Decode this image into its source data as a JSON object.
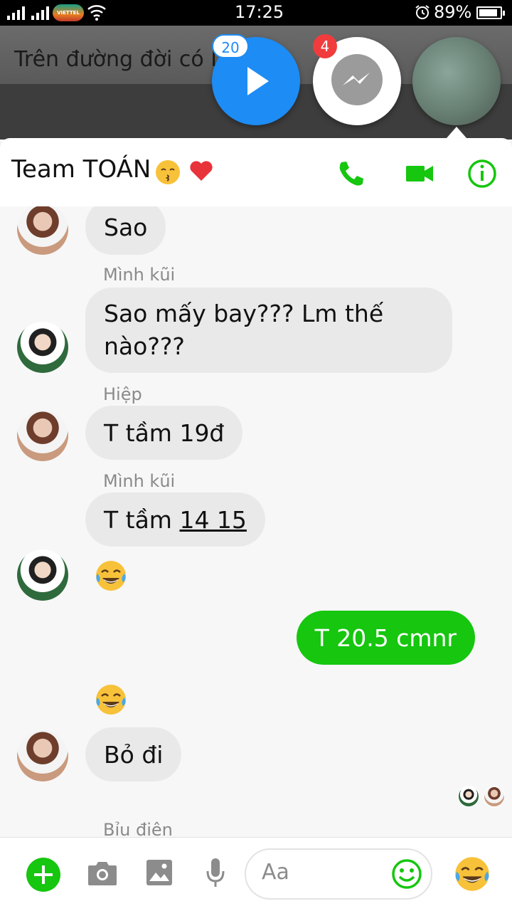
{
  "status_bar": {
    "time": "17:25",
    "battery": "89%",
    "battery_level": 0.89
  },
  "background_post": {
    "text": "Trên đường đời có Da    ên"
  },
  "chat_heads": {
    "play_badge": "20",
    "messenger_badge": "4"
  },
  "header": {
    "title": "Team TOÁN",
    "icons": [
      "kissing-emoji",
      "red-heart-emoji",
      "phone-icon",
      "video-icon",
      "info-icon"
    ],
    "accent_color": "#16c60f"
  },
  "messages": [
    {
      "sender": "",
      "text": "Sao",
      "mine": false
    },
    {
      "sender": "Mình kũi",
      "text": "Sao mấy bay??? Lm thế nào???",
      "mine": false
    },
    {
      "sender": "Hiệp",
      "text": "T tầm 19đ",
      "mine": false
    },
    {
      "sender": "Mình kũi",
      "text_prefix": "T tầm ",
      "text_underlined": "14 15",
      "mine": false
    },
    {
      "sender": "",
      "emoji": "face-with-tears-of-joy",
      "mine": false
    },
    {
      "sender": "",
      "text": "T 20.5 cmnr",
      "mine": true
    },
    {
      "sender": "",
      "emoji": "face-with-tears-of-joy",
      "mine": true
    },
    {
      "sender": "",
      "text": "Bỏ đi",
      "mine": false
    },
    {
      "sender": "Bỉu điên",
      "text": "",
      "mine": false
    }
  ],
  "composer": {
    "placeholder": "Aa",
    "icons": [
      "plus-icon",
      "camera-icon",
      "gallery-icon",
      "microphone-icon",
      "smiley-icon",
      "laughing-emoji"
    ]
  }
}
